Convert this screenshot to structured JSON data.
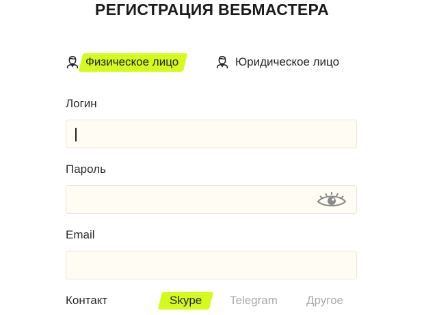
{
  "page": {
    "title": "РЕГИСТРАЦИЯ ВЕБМАСТЕРА"
  },
  "person_type": {
    "tabs": [
      {
        "label": "Физическое лицо",
        "icon": "user-icon",
        "selected": true
      },
      {
        "label": "Юридическое лицо",
        "icon": "user-icon",
        "selected": false
      }
    ]
  },
  "form": {
    "login": {
      "label": "Логин",
      "value": ""
    },
    "password": {
      "label": "Пароль",
      "value": "",
      "toggle_icon": "eye-icon"
    },
    "email": {
      "label": "Email",
      "value": ""
    },
    "contact": {
      "label": "Контакт",
      "options": [
        {
          "label": "Skype",
          "selected": true
        },
        {
          "label": "Telegram",
          "selected": false
        },
        {
          "label": "Другое",
          "selected": false
        }
      ]
    }
  },
  "colors": {
    "highlight": "#d4fa1e",
    "field_background": "#fffcf3",
    "inactive_text": "#a9a9a9"
  }
}
